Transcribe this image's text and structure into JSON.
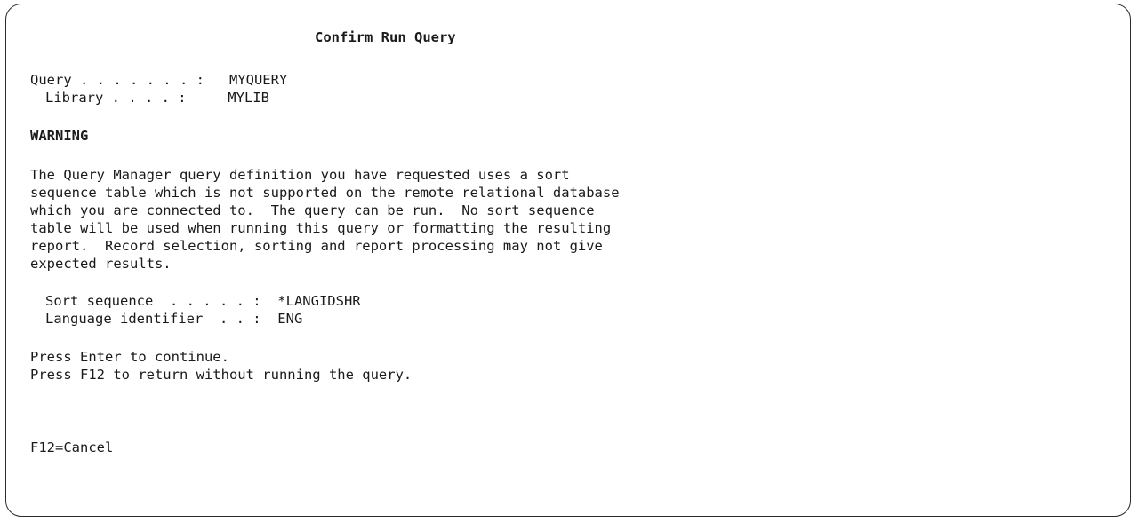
{
  "screen": {
    "title": "Confirm Run Query",
    "query_line": "Query . . . . . . . :   MYQUERY",
    "library_line": "Library . . . . :     MYLIB",
    "warning_heading": "WARNING",
    "warning_text": [
      "The Query Manager query definition you have requested uses a sort",
      "sequence table which is not supported on the remote relational database",
      "which you are connected to.  The query can be run.  No sort sequence",
      "table will be used when running this query or formatting the resulting",
      "report.  Record selection, sorting and report processing may not give",
      "expected results."
    ],
    "sort_sequence_line": "Sort sequence  . . . . . :  *LANGIDSHR",
    "language_identifier_line": "Language identifier  . . :  ENG",
    "instruction_enter": "Press Enter to continue.",
    "instruction_f12": "Press F12 to return without running the query.",
    "function_key_f12": "F12=Cancel"
  }
}
